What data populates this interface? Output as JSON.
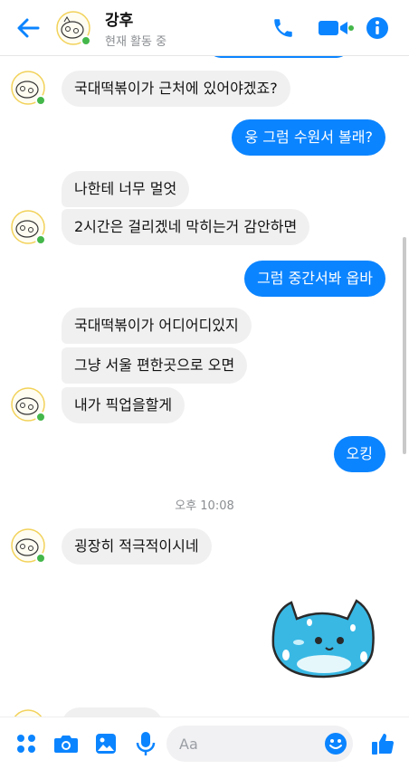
{
  "header": {
    "contact_name": "강후",
    "status_text": "현재 활동 중"
  },
  "messages": [
    {
      "from": "other",
      "text": "국대떡볶이가 근처에 있어야겠죠?"
    },
    {
      "from": "me",
      "text": "웅 그럼 수원서 볼래?"
    },
    {
      "from": "other",
      "text": "나한테 너무 멀엇"
    },
    {
      "from": "other",
      "text": "2시간은 걸리겠네 막히는거 감안하면"
    },
    {
      "from": "me",
      "text": "그럼 중간서봐 옵바"
    },
    {
      "from": "other",
      "text": "국대떡볶이가 어디어디있지"
    },
    {
      "from": "other",
      "text": "그냥 서울 편한곳으로 오면"
    },
    {
      "from": "other",
      "text": "내가 픽업을할게"
    },
    {
      "from": "me",
      "text": "오킹"
    },
    {
      "from": "other",
      "text": "굉장히 적극적이시네"
    }
  ],
  "timestamp": "오후 10:08",
  "sticker": {
    "from": "me",
    "name": "blue-cat-sticker"
  },
  "composer": {
    "placeholder": "Aa"
  },
  "colors": {
    "accent": "#0b84ff",
    "incoming_bubble": "#f1f0f0",
    "online": "#44b74a"
  },
  "icons": [
    "back-arrow-icon",
    "phone-icon",
    "video-icon",
    "info-icon",
    "more-apps-icon",
    "camera-icon",
    "gallery-icon",
    "microphone-icon",
    "emoji-icon",
    "like-icon"
  ]
}
